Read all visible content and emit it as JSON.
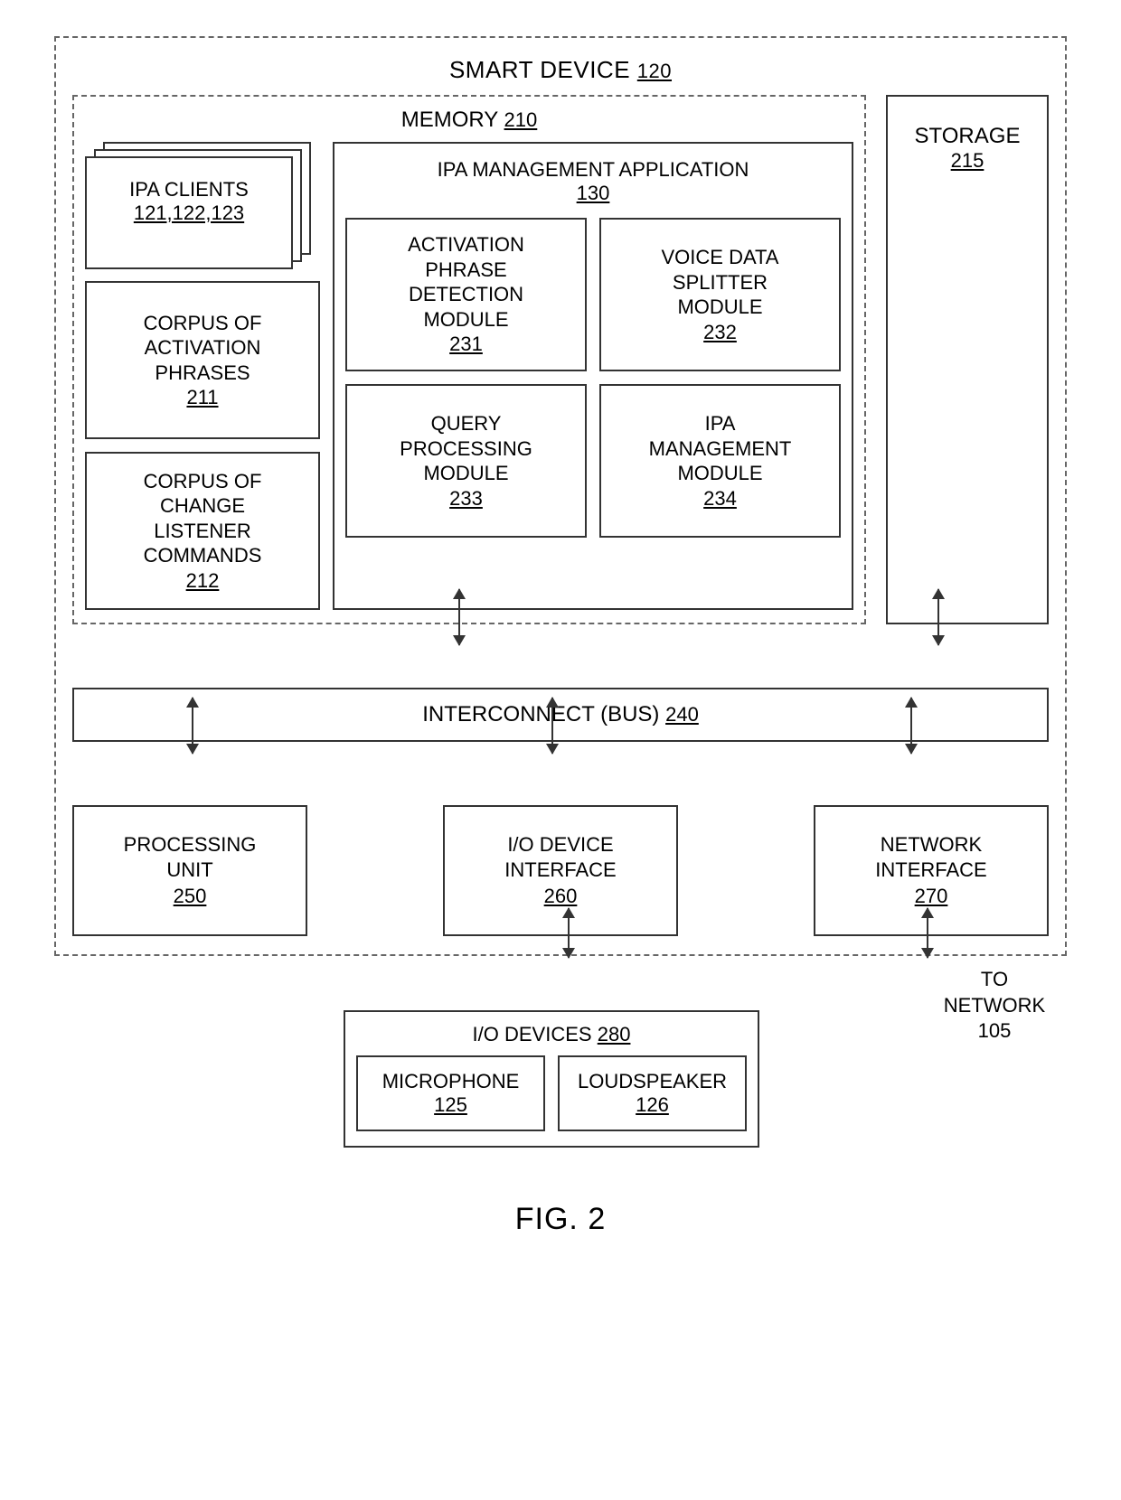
{
  "fig_label": "FIG. 2",
  "device": {
    "label": "SMART DEVICE",
    "num": "120"
  },
  "memory": {
    "label": "MEMORY",
    "num": "210"
  },
  "ipa_clients": {
    "label": "IPA CLIENTS",
    "nums": "121,122,123"
  },
  "corpus_act": {
    "l1": "CORPUS OF",
    "l2": "ACTIVATION",
    "l3": "PHRASES",
    "num": "211"
  },
  "corpus_chg": {
    "l1": "CORPUS OF",
    "l2": "CHANGE",
    "l3": "LISTENER",
    "l4": "COMMANDS",
    "num": "212"
  },
  "ipa_app": {
    "label": "IPA MANAGEMENT APPLICATION",
    "num": "130"
  },
  "mod_act": {
    "l1": "ACTIVATION",
    "l2": "PHRASE",
    "l3": "DETECTION",
    "l4": "MODULE",
    "num": "231"
  },
  "mod_split": {
    "l1": "VOICE DATA",
    "l2": "SPLITTER",
    "l3": "MODULE",
    "num": "232"
  },
  "mod_query": {
    "l1": "QUERY",
    "l2": "PROCESSING",
    "l3": "MODULE",
    "num": "233"
  },
  "mod_mgmt": {
    "l1": "IPA",
    "l2": "MANAGEMENT",
    "l3": "MODULE",
    "num": "234"
  },
  "storage": {
    "label": "STORAGE",
    "num": "215"
  },
  "bus": {
    "label": "INTERCONNECT (BUS)",
    "num": "240"
  },
  "proc": {
    "l1": "PROCESSING",
    "l2": "UNIT",
    "num": "250"
  },
  "ioif": {
    "l1": "I/O DEVICE",
    "l2": "INTERFACE",
    "num": "260"
  },
  "netif": {
    "l1": "NETWORK",
    "l2": "INTERFACE",
    "num": "270"
  },
  "iodev": {
    "label": "I/O DEVICES",
    "num": "280"
  },
  "mic": {
    "label": "MICROPHONE",
    "num": "125"
  },
  "spk": {
    "label": "LOUDSPEAKER",
    "num": "126"
  },
  "to_net": {
    "l1": "TO",
    "l2": "NETWORK",
    "num": "105"
  }
}
